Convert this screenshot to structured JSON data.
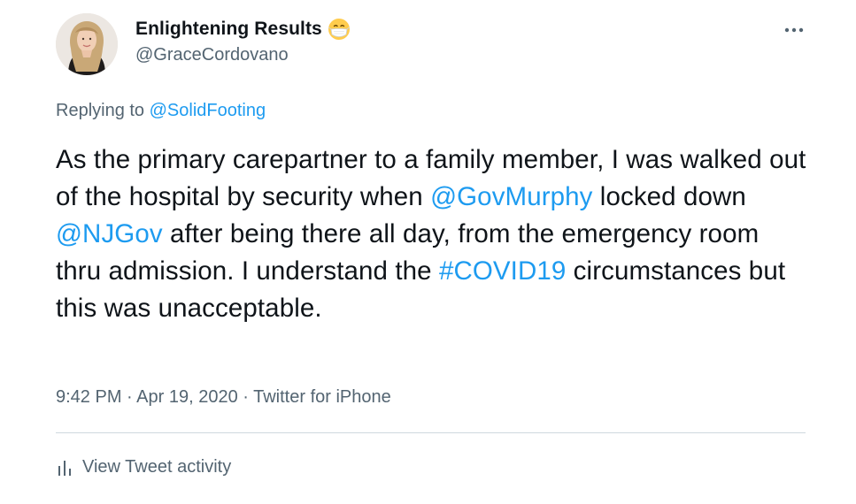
{
  "author": {
    "display_name": "Enlightening Results",
    "handle": "@GraceCordovano",
    "avatar_icon": "profile-photo",
    "name_emoji_icon": "face-with-medical-mask-icon"
  },
  "reply": {
    "prefix": "Replying to ",
    "mention": "@SolidFooting"
  },
  "tweet": {
    "segments": [
      {
        "text": "As the primary carepartner to a family member, I was walked out of the hospital by security when ",
        "type": "text"
      },
      {
        "text": "@GovMurphy",
        "type": "mention"
      },
      {
        "text": " locked down ",
        "type": "text"
      },
      {
        "text": "@NJGov",
        "type": "mention"
      },
      {
        "text": " after being there all day, from the emergency room thru admission. I understand the ",
        "type": "text"
      },
      {
        "text": "#COVID19",
        "type": "hashtag"
      },
      {
        "text": " circumstances but this was unacceptable.",
        "type": "text"
      }
    ]
  },
  "meta": {
    "time": "9:42 PM",
    "separator_1": " · ",
    "date": "Apr 19, 2020",
    "separator_2": " · ",
    "source": "Twitter for iPhone"
  },
  "actions": {
    "activity_label": "View Tweet activity",
    "activity_icon": "bar-chart-icon",
    "more_icon": "more-horizontal-icon"
  },
  "colors": {
    "link": "#1d9bf0",
    "secondary_text": "#536471",
    "primary_text": "#0f1419",
    "divider": "#cfd9de"
  }
}
